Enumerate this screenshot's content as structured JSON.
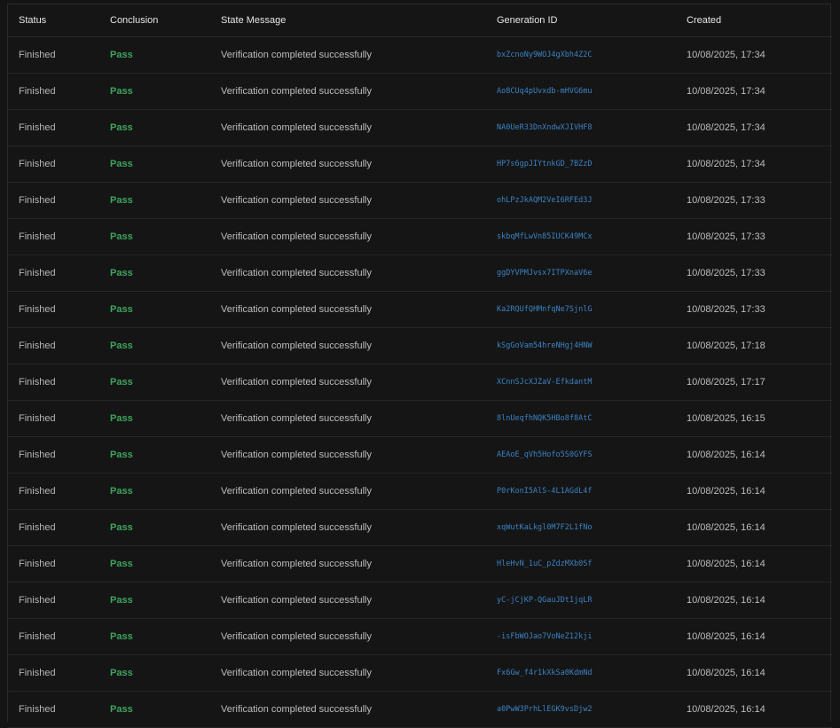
{
  "table": {
    "headers": {
      "status": "Status",
      "conclusion": "Conclusion",
      "state_message": "State Message",
      "generation_id": "Generation ID",
      "created": "Created"
    },
    "rows": [
      {
        "status": "Finished",
        "conclusion": "Pass",
        "state_message": "Verification completed successfully",
        "generation_id": "bxZcnoNy9WOJ4gXbh4Z2C",
        "created": "10/08/2025, 17:34"
      },
      {
        "status": "Finished",
        "conclusion": "Pass",
        "state_message": "Verification completed successfully",
        "generation_id": "Ao8CUq4pUvxdb-mHVG6mu",
        "created": "10/08/2025, 17:34"
      },
      {
        "status": "Finished",
        "conclusion": "Pass",
        "state_message": "Verification completed successfully",
        "generation_id": "NA0UeR33DnXndwXJIVHF8",
        "created": "10/08/2025, 17:34"
      },
      {
        "status": "Finished",
        "conclusion": "Pass",
        "state_message": "Verification completed successfully",
        "generation_id": "HP7s6gpJIYtnkGD_7BZzD",
        "created": "10/08/2025, 17:34"
      },
      {
        "status": "Finished",
        "conclusion": "Pass",
        "state_message": "Verification completed successfully",
        "generation_id": "ohLPzJkAQM2VeI6RFEd3J",
        "created": "10/08/2025, 17:33"
      },
      {
        "status": "Finished",
        "conclusion": "Pass",
        "state_message": "Verification completed successfully",
        "generation_id": "skbqMfLwVn85IUCK49MCx",
        "created": "10/08/2025, 17:33"
      },
      {
        "status": "Finished",
        "conclusion": "Pass",
        "state_message": "Verification completed successfully",
        "generation_id": "ggDYVPMJvsx7ITPXnaV6e",
        "created": "10/08/2025, 17:33"
      },
      {
        "status": "Finished",
        "conclusion": "Pass",
        "state_message": "Verification completed successfully",
        "generation_id": "Ka2RQUfQHMnfqNe7SjnlG",
        "created": "10/08/2025, 17:33"
      },
      {
        "status": "Finished",
        "conclusion": "Pass",
        "state_message": "Verification completed successfully",
        "generation_id": "kSgGoVam54hreNHgj4HNW",
        "created": "10/08/2025, 17:18"
      },
      {
        "status": "Finished",
        "conclusion": "Pass",
        "state_message": "Verification completed successfully",
        "generation_id": "XCnnSJcXJZaV-EfkdantM",
        "created": "10/08/2025, 17:17"
      },
      {
        "status": "Finished",
        "conclusion": "Pass",
        "state_message": "Verification completed successfully",
        "generation_id": "8lnUeqfhNQK5HBo8f8AtC",
        "created": "10/08/2025, 16:15"
      },
      {
        "status": "Finished",
        "conclusion": "Pass",
        "state_message": "Verification completed successfully",
        "generation_id": "AEAoE_qVh5Hofo5S0GYFS",
        "created": "10/08/2025, 16:14"
      },
      {
        "status": "Finished",
        "conclusion": "Pass",
        "state_message": "Verification completed successfully",
        "generation_id": "P0rKonI5AlS-4L1AGdL4f",
        "created": "10/08/2025, 16:14"
      },
      {
        "status": "Finished",
        "conclusion": "Pass",
        "state_message": "Verification completed successfully",
        "generation_id": "xqWutKaLkgl0M7F2L1fNo",
        "created": "10/08/2025, 16:14"
      },
      {
        "status": "Finished",
        "conclusion": "Pass",
        "state_message": "Verification completed successfully",
        "generation_id": "HleHvN_1uC_pZdzMXb0Sf",
        "created": "10/08/2025, 16:14"
      },
      {
        "status": "Finished",
        "conclusion": "Pass",
        "state_message": "Verification completed successfully",
        "generation_id": "yC-jCjKP-QGauJDt1jqLR",
        "created": "10/08/2025, 16:14"
      },
      {
        "status": "Finished",
        "conclusion": "Pass",
        "state_message": "Verification completed successfully",
        "generation_id": "-isFbWOJao7VoNeZ12kji",
        "created": "10/08/2025, 16:14"
      },
      {
        "status": "Finished",
        "conclusion": "Pass",
        "state_message": "Verification completed successfully",
        "generation_id": "Fx6Gw_f4r1kXkSa0KdmNd",
        "created": "10/08/2025, 16:14"
      },
      {
        "status": "Finished",
        "conclusion": "Pass",
        "state_message": "Verification completed successfully",
        "generation_id": "a0PwW3PrhLlEGK9vsDjw2",
        "created": "10/08/2025, 16:14"
      }
    ]
  },
  "colors": {
    "background": "#141414",
    "pass": "#3ea45d",
    "link": "#3b82c4",
    "border": "#262626"
  }
}
